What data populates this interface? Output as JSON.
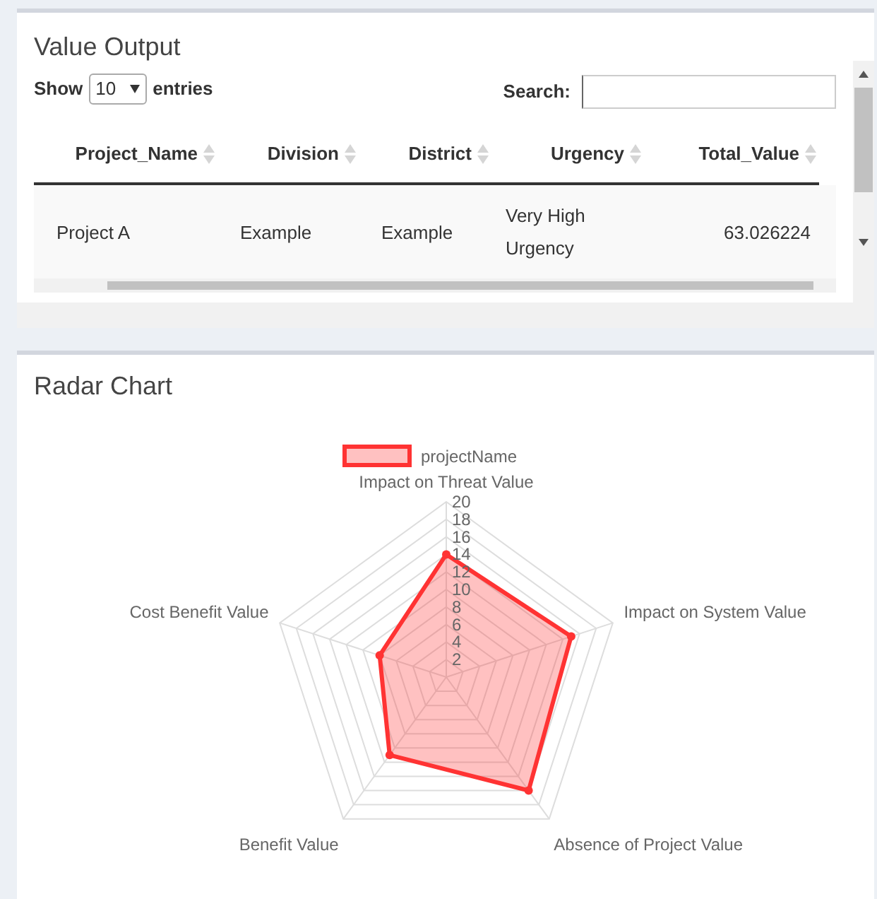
{
  "table_box": {
    "title": "Value Output",
    "length": {
      "label_before": "Show",
      "value": "10",
      "label_after": "entries"
    },
    "search": {
      "label": "Search:"
    },
    "columns": [
      "Project_Name",
      "Division",
      "District",
      "Urgency",
      "Total_Value"
    ],
    "rows": [
      [
        "Project A",
        "Example",
        "Example",
        "Very High Urgency",
        "63.026224"
      ]
    ]
  },
  "chart_box": {
    "title": "Radar Chart",
    "chart_data": {
      "type": "radar",
      "categories": [
        "Impact on Threat Value",
        "Impact on System Value",
        "Absence of Project Value",
        "Benefit Value",
        "Cost Benefit Value"
      ],
      "ylim": [
        0,
        20
      ],
      "yticks": [
        2,
        4,
        6,
        8,
        10,
        12,
        14,
        16,
        18,
        20
      ],
      "series": [
        {
          "name": "projectName",
          "color": "#ff3333",
          "values": [
            14,
            15,
            16,
            11,
            8
          ]
        }
      ]
    }
  }
}
